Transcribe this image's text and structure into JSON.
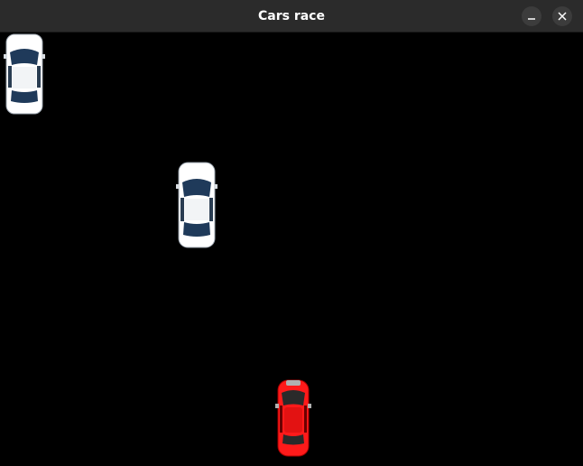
{
  "window": {
    "title": "Cars race",
    "controls": [
      "minimize",
      "close"
    ]
  },
  "game": {
    "background": "#000000",
    "cars": [
      {
        "role": "opponent",
        "color": "#ffffff",
        "window_color": "#1f3a5a"
      },
      {
        "role": "opponent",
        "color": "#ffffff",
        "window_color": "#1f3a5a"
      },
      {
        "role": "player",
        "color": "#ff1a1a",
        "window_color": "#2a2a2a"
      }
    ]
  }
}
